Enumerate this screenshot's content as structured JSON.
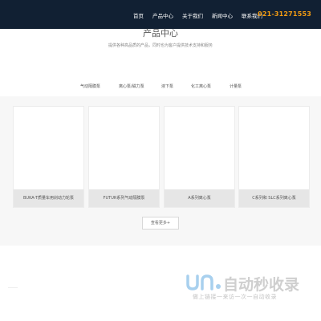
{
  "header": {
    "nav": [
      "首页",
      "产品中心",
      "关于我们",
      "新闻中心",
      "联系我们"
    ],
    "phone": "021-31271553"
  },
  "section": {
    "title": "产品中心",
    "subtitle": "提供各种高品质的产品，同时也为客户提供技术支持和服务"
  },
  "tabs": [
    "气动隔膜泵",
    "离心泵/磁力泵",
    "液下泵",
    "化工离心泵",
    "计量泵"
  ],
  "products": [
    {
      "label": "BUKA-T质量车用刹动力轮泵"
    },
    {
      "label": "FUTUR系列气动隔膜泵"
    },
    {
      "label": "A系列离心泵"
    },
    {
      "label": "C系列和 SLC系列离心泵"
    }
  ],
  "more_button": "查看更多+",
  "watermark": {
    "text": "自动秒收录",
    "slogan": "做上链接一来访一次一自动收录",
    "colors": {
      "blue": "#a8d0ee",
      "gray": "#cfcfcf"
    }
  }
}
